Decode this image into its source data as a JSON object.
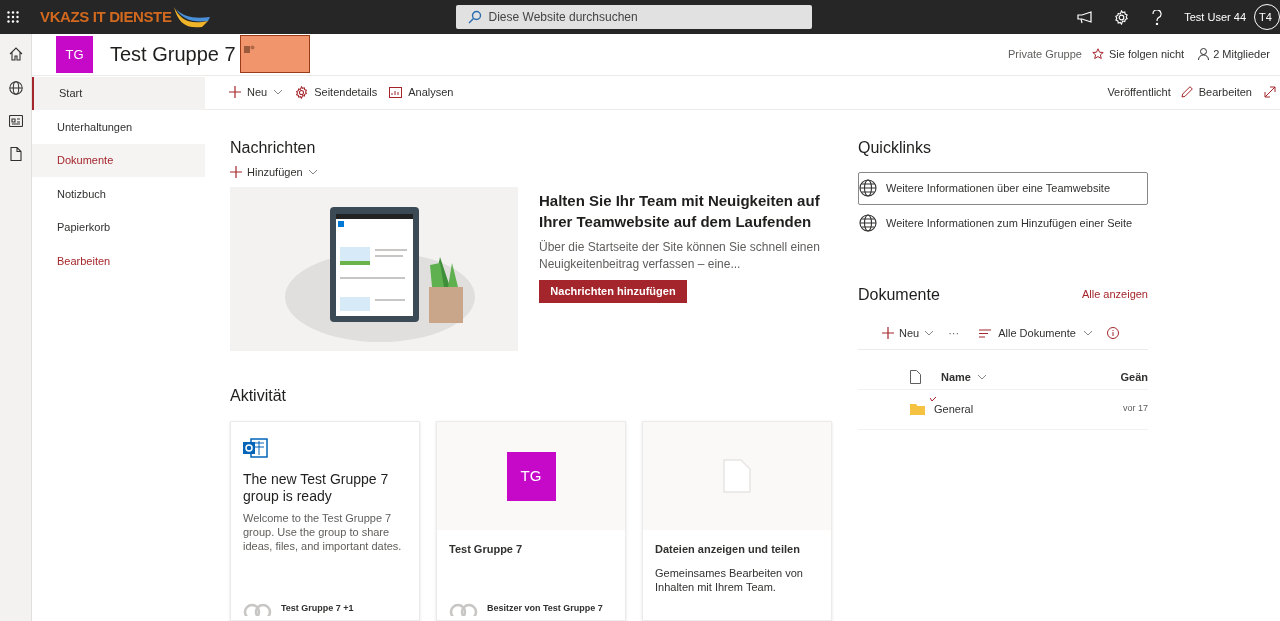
{
  "top_bar": {
    "brand": "VKAZS IT DIENSTE",
    "search": {
      "placeholder": "Diese Website durchsuchen"
    },
    "user_name": "Test User 44",
    "avatar_initials": "T4"
  },
  "site_header": {
    "logo_initials": "TG",
    "title": "Test Gruppe 7",
    "redacted": true,
    "privacy": "Private Gruppe",
    "follow": "Sie folgen nicht",
    "members": "2 Mitglieder"
  },
  "nav": [
    {
      "label": "Start",
      "selected": true,
      "kind": "page",
      "hovered": false
    },
    {
      "label": "Unterhaltungen",
      "selected": false,
      "kind": "page",
      "hovered": false
    },
    {
      "label": "Dokumente",
      "selected": false,
      "kind": "page",
      "hovered": true
    },
    {
      "label": "Notizbuch",
      "selected": false,
      "kind": "page",
      "hovered": false
    },
    {
      "label": "Papierkorb",
      "selected": false,
      "kind": "page",
      "hovered": false
    },
    {
      "label": "Bearbeiten",
      "selected": false,
      "kind": "edit",
      "hovered": false
    }
  ],
  "command_bar": {
    "new": "Neu",
    "details": "Seitendetails",
    "analytics": "Analysen",
    "status": "Veröffentlicht",
    "edit": "Bearbeiten"
  },
  "news": {
    "title": "Nachrichten",
    "add": "Hinzufügen",
    "heading": "Halten Sie Ihr Team mit Neuigkeiten auf Ihrer Teamwebsite auf dem Laufenden",
    "body": "Über die Startseite der Site können Sie schnell einen Neuigkeitenbeitrag verfassen – eine...",
    "button": "Nachrichten hinzufügen"
  },
  "activity": {
    "title": "Aktivität",
    "cards": [
      {
        "kind": "welcome",
        "title": "The new Test Gruppe 7 group is ready",
        "body": "Welcome to the Test Gruppe 7 group. Use the group to share ideas, files, and important dates.",
        "footer": "Test Gruppe 7 +1"
      },
      {
        "kind": "group",
        "initials": "TG",
        "title": "Test Gruppe 7",
        "footer": "Besitzer von Test Gruppe 7"
      },
      {
        "kind": "files",
        "title": "Dateien anzeigen und teilen",
        "body": "Gemeinsames Bearbeiten von Inhalten mit Ihrem Team."
      }
    ]
  },
  "quicklinks": {
    "title": "Quicklinks",
    "items": [
      {
        "label": "Weitere Informationen über eine Teamwebsite",
        "selected": true
      },
      {
        "label": "Weitere Informationen zum Hinzufügen einer Seite",
        "selected": false
      }
    ]
  },
  "documents": {
    "title": "Dokumente",
    "see_all": "Alle anzeigen",
    "new": "Neu",
    "more": "···",
    "view": "Alle Dokumente",
    "columns": [
      "Name",
      "Geän"
    ],
    "rows": [
      {
        "name": "General",
        "modified": "vor 17",
        "is_new": true
      }
    ]
  }
}
